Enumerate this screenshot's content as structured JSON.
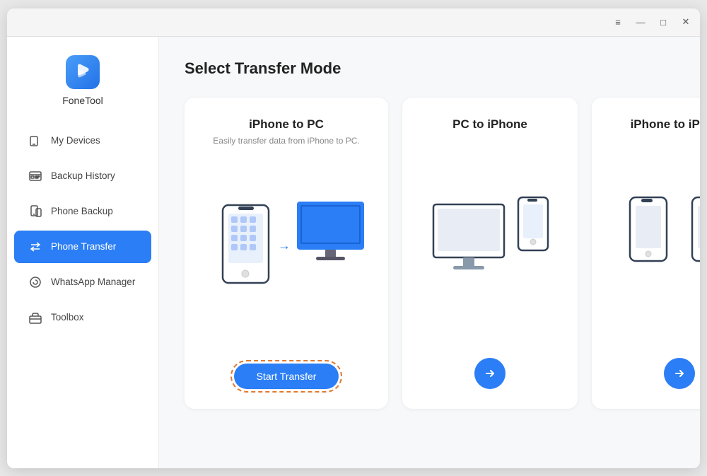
{
  "app": {
    "name": "FoneTool"
  },
  "titlebar": {
    "menu_icon": "≡",
    "minimize_icon": "—",
    "maximize_icon": "□",
    "close_icon": "✕"
  },
  "sidebar": {
    "items": [
      {
        "id": "my-devices",
        "label": "My Devices",
        "icon": "device-icon",
        "active": false
      },
      {
        "id": "backup-history",
        "label": "Backup History",
        "icon": "backup-icon",
        "active": false
      },
      {
        "id": "phone-backup",
        "label": "Phone Backup",
        "icon": "phone-backup-icon",
        "active": false
      },
      {
        "id": "phone-transfer",
        "label": "Phone Transfer",
        "icon": "transfer-icon",
        "active": true
      },
      {
        "id": "whatsapp-manager",
        "label": "WhatsApp Manager",
        "icon": "whatsapp-icon",
        "active": false
      },
      {
        "id": "toolbox",
        "label": "Toolbox",
        "icon": "toolbox-icon",
        "active": false
      }
    ]
  },
  "main": {
    "page_title": "Select Transfer Mode",
    "cards": [
      {
        "id": "iphone-to-pc",
        "title": "iPhone to PC",
        "subtitle": "Easily transfer data from iPhone to PC.",
        "action_label": "Start Transfer",
        "action_type": "button"
      },
      {
        "id": "pc-to-iphone",
        "title": "PC to iPhone",
        "subtitle": "",
        "action_type": "arrow"
      },
      {
        "id": "iphone-to-iphone",
        "title": "iPhone to iPhone",
        "subtitle": "",
        "action_type": "arrow"
      }
    ]
  }
}
